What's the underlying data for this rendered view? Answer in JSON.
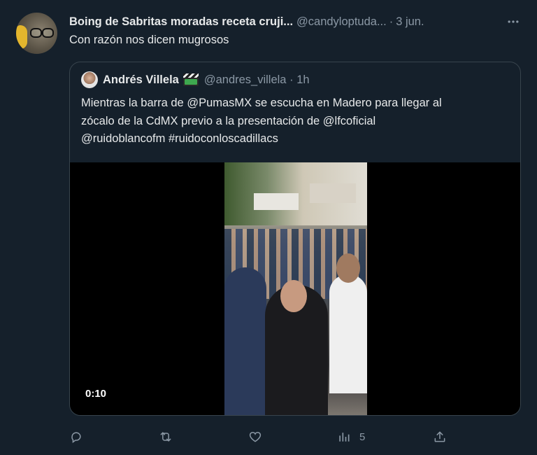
{
  "tweet": {
    "author_name": "Boing de Sabritas moradas receta cruji...",
    "author_handle": "@candyloptuda...",
    "separator": "·",
    "date": "3 jun.",
    "text": "Con razón nos dicen mugrosos",
    "more_icon": "more-horizontal-icon"
  },
  "quote": {
    "author_name": "Andrés Villela",
    "badge_icon": "clapperboard-emoji",
    "author_handle": "@andres_villela",
    "separator": "·",
    "time": "1h",
    "lines": [
      "Mientras la barra de @PumasMX se escucha en Madero para llegar al",
      "zócalo de la CdMX previo a la presentación de @lfcoficial",
      "@ruidoblancofm #ruidoconloscadillacs"
    ],
    "video": {
      "timecode": "0:10"
    }
  },
  "actions": {
    "reply_icon": "reply-icon",
    "retweet_icon": "retweet-icon",
    "like_icon": "heart-icon",
    "views_icon": "views-chart-icon",
    "views_count": "5",
    "share_icon": "share-icon"
  },
  "colors": {
    "background": "#15202b",
    "text_primary": "#e7e9ea",
    "text_secondary": "#8b98a5",
    "border": "#38444d"
  }
}
